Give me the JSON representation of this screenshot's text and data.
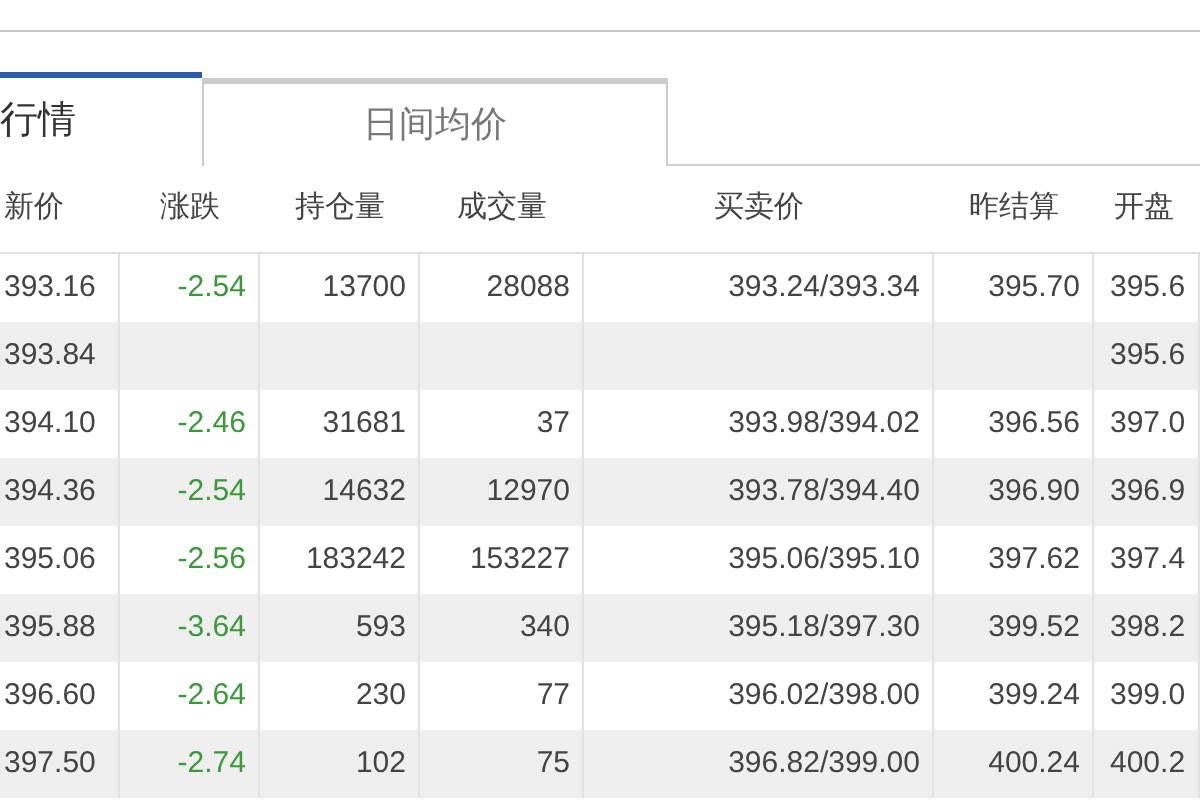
{
  "tabs": [
    {
      "label": "行情",
      "selected": true
    },
    {
      "label": "日间均价",
      "selected": false
    }
  ],
  "table": {
    "columns": [
      "新价",
      "涨跌",
      "持仓量",
      "成交量",
      "买卖价",
      "昨结算",
      "开盘"
    ],
    "rows": [
      [
        "393.16",
        "-2.54",
        "13700",
        "28088",
        "393.24/393.34",
        "395.70",
        "395.6"
      ],
      [
        "393.84",
        null,
        null,
        null,
        null,
        null,
        "395.6"
      ],
      [
        "394.10",
        "-2.46",
        "31681",
        "37",
        "393.98/394.02",
        "396.56",
        "397.0"
      ],
      [
        "394.36",
        "-2.54",
        "14632",
        "12970",
        "393.78/394.40",
        "396.90",
        "396.9"
      ],
      [
        "395.06",
        "-2.56",
        "183242",
        "153227",
        "395.06/395.10",
        "397.62",
        "397.4"
      ],
      [
        "395.88",
        "-3.64",
        "593",
        "340",
        "395.18/397.30",
        "399.52",
        "398.2"
      ],
      [
        "396.60",
        "-2.64",
        "230",
        "77",
        "396.02/398.00",
        "399.24",
        "399.0"
      ],
      [
        "397.50",
        "-2.74",
        "102",
        "75",
        "396.82/399.00",
        "400.24",
        "400.2"
      ]
    ]
  }
}
